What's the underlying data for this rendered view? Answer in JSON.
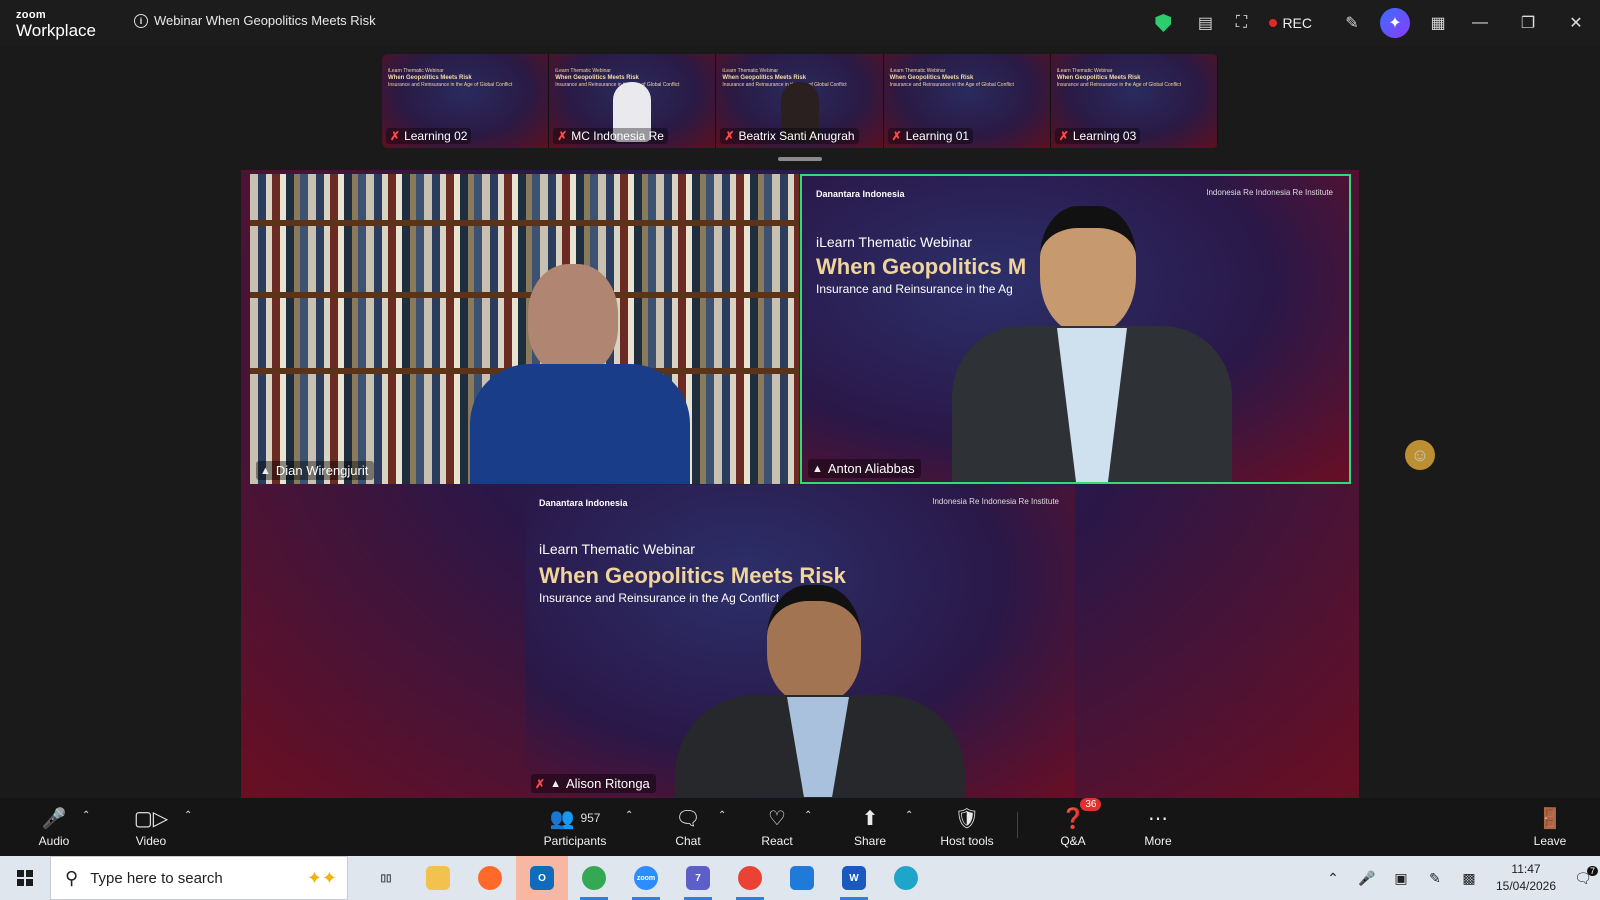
{
  "app": {
    "brand_top": "zoom",
    "brand_bottom": "Workplace",
    "meeting_title": "Webinar When Geopolitics Meets Risk"
  },
  "titlebar": {
    "rec_label": "REC"
  },
  "thumbnails": [
    {
      "name": "Learning 02"
    },
    {
      "name": "MC Indonesia Re"
    },
    {
      "name": "Beatrix Santi Anugrah"
    },
    {
      "name": "Learning 01"
    },
    {
      "name": "Learning 03"
    }
  ],
  "thumbnail_slide": {
    "kicker": "iLearn Thematic Webinar",
    "title": "When Geopolitics Meets Risk",
    "subtitle": "Insurance and Reinsurance in the Age of Global Conflict"
  },
  "tiles": {
    "dian": {
      "name": "Dian Wirengjurit"
    },
    "anton": {
      "name": "Anton Aliabbas",
      "brand": "Danantara Indonesia",
      "logos": "Indonesia Re  Indonesia Re Institute",
      "kicker": "iLearn Thematic Webinar",
      "title": "When Geopolitics M",
      "subtitle": "Insurance and Reinsurance in the Ag",
      "institute": "Indonesia Re Institute"
    },
    "alison": {
      "name": "Alison Ritonga",
      "brand": "Danantara Indonesia",
      "logos": "Indonesia Re  Indonesia Re Institute",
      "kicker": "iLearn Thematic Webinar",
      "title": "When Geopolitics Meets Risk",
      "subtitle": "Insurance and Reinsurance in the Ag       Conflict",
      "institute": "Indonesia Re Institute"
    }
  },
  "toolbar": {
    "audio": "Audio",
    "video": "Video",
    "participants": "Participants",
    "participants_count": "957",
    "chat": "Chat",
    "react": "React",
    "share": "Share",
    "host_tools": "Host tools",
    "qa": "Q&A",
    "qa_badge": "36",
    "more": "More",
    "leave": "Leave"
  },
  "taskbar": {
    "search_placeholder": "Type here to search",
    "time": "11:47",
    "date": "15/04/2026",
    "teams_badge": "7",
    "notif_badge": "7"
  },
  "colors": {
    "active_speaker": "#2fdc7a",
    "rec_dot": "#e02828",
    "badge": "#e03131",
    "slide_title": "#f0d49c"
  }
}
